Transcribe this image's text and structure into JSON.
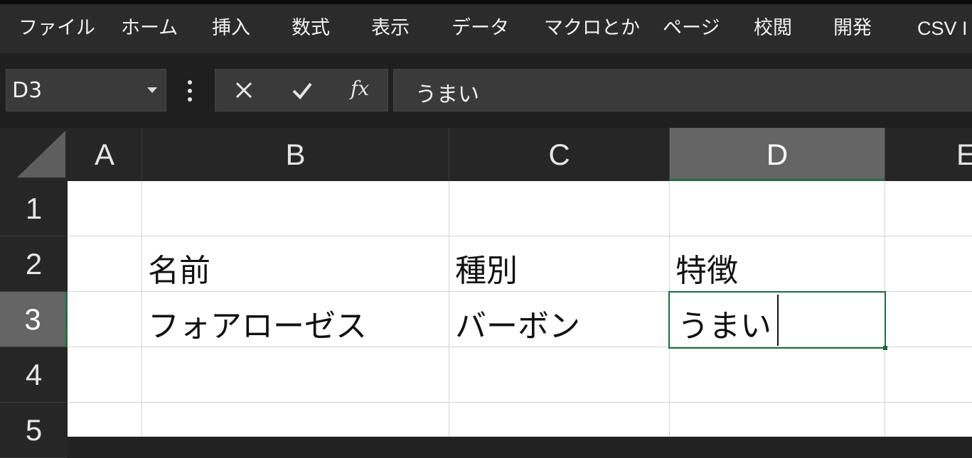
{
  "ribbon": {
    "tabs": [
      "ファイル",
      "ホーム",
      "挿入",
      "数式",
      "表示",
      "データ",
      "マクロとか",
      "ページ",
      "校閲",
      "開発",
      "CSV I"
    ]
  },
  "formula_bar": {
    "name_box": "D3",
    "cancel_icon": "close-icon",
    "enter_icon": "check-icon",
    "fx_label": "fx",
    "formula_value": "うまい"
  },
  "grid": {
    "columns": [
      "A",
      "B",
      "C",
      "D",
      "E"
    ],
    "rows": [
      "1",
      "2",
      "3",
      "4",
      "5"
    ],
    "selected_column": "D",
    "selected_row": "3",
    "cells": {
      "B2": "名前",
      "C2": "種別",
      "D2": "特徴",
      "B3": "フォアローゼス",
      "C3": "バーボン",
      "D3": "うまい"
    }
  },
  "colors": {
    "selection_green": "#1e6b3e",
    "header_selected": "#656565",
    "dark_bg": "#222222"
  }
}
